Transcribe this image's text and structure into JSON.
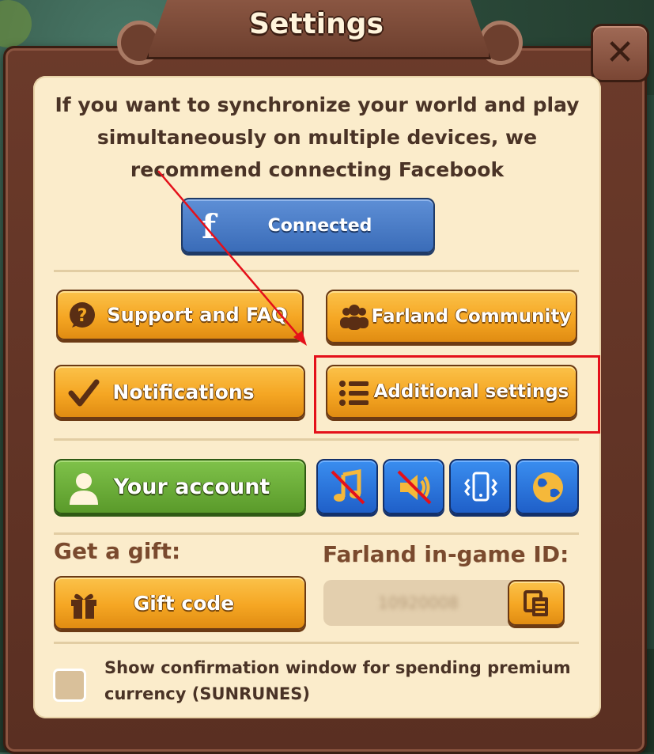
{
  "title": "Settings",
  "intro_text": "If you want to synchronize your world and play simultaneously on multiple devices, we recommend connecting Facebook",
  "facebook_button": {
    "icon": "facebook-icon",
    "label": "Connected"
  },
  "buttons": {
    "support": {
      "icon": "question-bubble-icon",
      "label": "Support and FAQ"
    },
    "community": {
      "icon": "people-icon",
      "label": "Farland Community"
    },
    "notifications": {
      "icon": "checkmark-icon",
      "label": "Notifications"
    },
    "additional": {
      "icon": "list-icon",
      "label": "Additional settings"
    },
    "account": {
      "icon": "user-icon",
      "label": "Your account"
    },
    "gift": {
      "icon": "gift-icon",
      "label": "Gift code"
    }
  },
  "toggles": [
    {
      "name": "music",
      "icon": "music-note-icon",
      "state": "off"
    },
    {
      "name": "sound",
      "icon": "speaker-icon",
      "state": "off"
    },
    {
      "name": "vibration",
      "icon": "vibration-icon",
      "state": "on"
    },
    {
      "name": "language",
      "icon": "globe-icon",
      "state": "on"
    }
  ],
  "gift_label": "Get a gift:",
  "id_label": "Farland in-game ID:",
  "id_value": "10920008",
  "confirm_text": "Show confirmation window for spending premium currency (SUNRUNES)",
  "confirm_checked": false,
  "colors": {
    "frame": "#6b3a2a",
    "panel": "#fbeccb",
    "orange_button": "#f5a623",
    "blue_button": "#3a6cb8",
    "green_button": "#5a9a2a",
    "annotation": "#e4101a"
  }
}
